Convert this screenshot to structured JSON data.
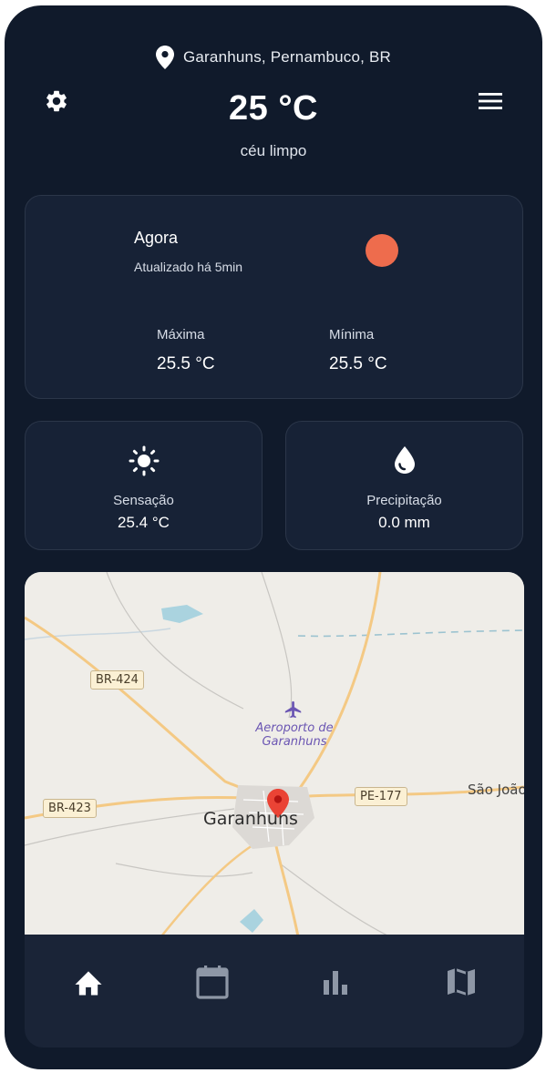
{
  "header": {
    "location": "Garanhuns, Pernambuco, BR",
    "temperature": "25 °C",
    "condition": "céu limpo",
    "icons": {
      "location": "map-pin-icon",
      "settings": "gear-icon",
      "menu": "hamburger-menu-icon"
    }
  },
  "now_card": {
    "title": "Agora",
    "updated": "Atualizado há 5min",
    "max_label": "Máxima",
    "max_value": "25.5 °C",
    "min_label": "Mínima",
    "min_value": "25.5 °C",
    "sun_color": "#ee6c4d"
  },
  "feels_card": {
    "label": "Sensação",
    "value": "25.4 °C",
    "icon": "sun-icon"
  },
  "rain_card": {
    "label": "Precipitação",
    "value": "0.0 mm",
    "icon": "water-drop-icon"
  },
  "map": {
    "roads": [
      "BR-424",
      "BR-423",
      "PE-177"
    ],
    "city": "Garanhuns",
    "town": "São João",
    "airport": "Aeroporto de Garanhuns",
    "icons": {
      "marker": "map-marker-icon",
      "airport": "airplane-icon"
    }
  },
  "bottom_nav": {
    "items": [
      {
        "name": "home",
        "icon": "home-icon",
        "active": true
      },
      {
        "name": "calendar",
        "icon": "calendar-icon",
        "active": false
      },
      {
        "name": "charts",
        "icon": "bar-chart-icon",
        "active": false
      },
      {
        "name": "map",
        "icon": "map-icon",
        "active": false
      }
    ]
  },
  "colors": {
    "background": "#101a2b",
    "card": "#172236",
    "accent": "#ee6c4d"
  }
}
